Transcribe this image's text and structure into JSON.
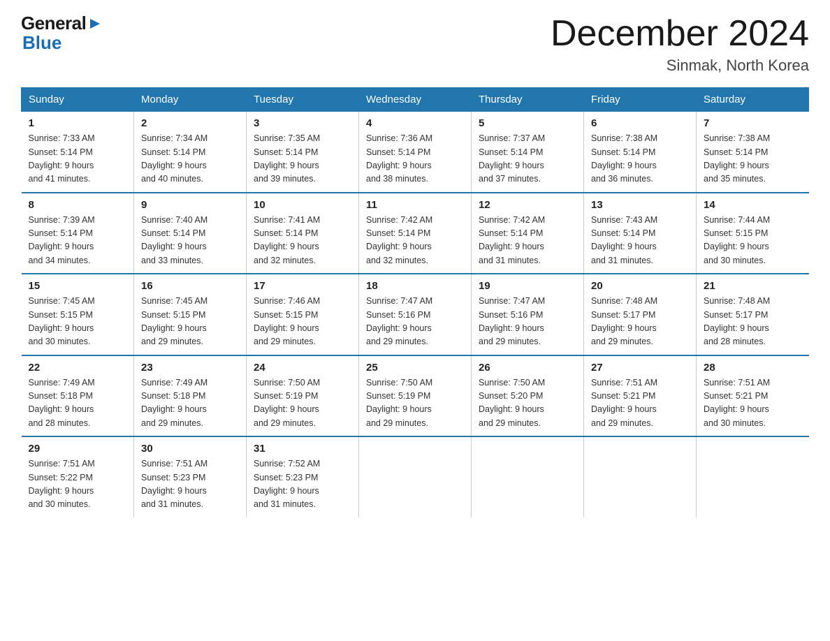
{
  "logo": {
    "general": "General",
    "blue": "Blue",
    "arrow": "▶"
  },
  "title": "December 2024",
  "location": "Sinmak, North Korea",
  "days_of_week": [
    "Sunday",
    "Monday",
    "Tuesday",
    "Wednesday",
    "Thursday",
    "Friday",
    "Saturday"
  ],
  "weeks": [
    [
      {
        "day": "1",
        "sunrise": "7:33 AM",
        "sunset": "5:14 PM",
        "daylight": "9 hours and 41 minutes."
      },
      {
        "day": "2",
        "sunrise": "7:34 AM",
        "sunset": "5:14 PM",
        "daylight": "9 hours and 40 minutes."
      },
      {
        "day": "3",
        "sunrise": "7:35 AM",
        "sunset": "5:14 PM",
        "daylight": "9 hours and 39 minutes."
      },
      {
        "day": "4",
        "sunrise": "7:36 AM",
        "sunset": "5:14 PM",
        "daylight": "9 hours and 38 minutes."
      },
      {
        "day": "5",
        "sunrise": "7:37 AM",
        "sunset": "5:14 PM",
        "daylight": "9 hours and 37 minutes."
      },
      {
        "day": "6",
        "sunrise": "7:38 AM",
        "sunset": "5:14 PM",
        "daylight": "9 hours and 36 minutes."
      },
      {
        "day": "7",
        "sunrise": "7:38 AM",
        "sunset": "5:14 PM",
        "daylight": "9 hours and 35 minutes."
      }
    ],
    [
      {
        "day": "8",
        "sunrise": "7:39 AM",
        "sunset": "5:14 PM",
        "daylight": "9 hours and 34 minutes."
      },
      {
        "day": "9",
        "sunrise": "7:40 AM",
        "sunset": "5:14 PM",
        "daylight": "9 hours and 33 minutes."
      },
      {
        "day": "10",
        "sunrise": "7:41 AM",
        "sunset": "5:14 PM",
        "daylight": "9 hours and 32 minutes."
      },
      {
        "day": "11",
        "sunrise": "7:42 AM",
        "sunset": "5:14 PM",
        "daylight": "9 hours and 32 minutes."
      },
      {
        "day": "12",
        "sunrise": "7:42 AM",
        "sunset": "5:14 PM",
        "daylight": "9 hours and 31 minutes."
      },
      {
        "day": "13",
        "sunrise": "7:43 AM",
        "sunset": "5:14 PM",
        "daylight": "9 hours and 31 minutes."
      },
      {
        "day": "14",
        "sunrise": "7:44 AM",
        "sunset": "5:15 PM",
        "daylight": "9 hours and 30 minutes."
      }
    ],
    [
      {
        "day": "15",
        "sunrise": "7:45 AM",
        "sunset": "5:15 PM",
        "daylight": "9 hours and 30 minutes."
      },
      {
        "day": "16",
        "sunrise": "7:45 AM",
        "sunset": "5:15 PM",
        "daylight": "9 hours and 29 minutes."
      },
      {
        "day": "17",
        "sunrise": "7:46 AM",
        "sunset": "5:15 PM",
        "daylight": "9 hours and 29 minutes."
      },
      {
        "day": "18",
        "sunrise": "7:47 AM",
        "sunset": "5:16 PM",
        "daylight": "9 hours and 29 minutes."
      },
      {
        "day": "19",
        "sunrise": "7:47 AM",
        "sunset": "5:16 PM",
        "daylight": "9 hours and 29 minutes."
      },
      {
        "day": "20",
        "sunrise": "7:48 AM",
        "sunset": "5:17 PM",
        "daylight": "9 hours and 29 minutes."
      },
      {
        "day": "21",
        "sunrise": "7:48 AM",
        "sunset": "5:17 PM",
        "daylight": "9 hours and 28 minutes."
      }
    ],
    [
      {
        "day": "22",
        "sunrise": "7:49 AM",
        "sunset": "5:18 PM",
        "daylight": "9 hours and 28 minutes."
      },
      {
        "day": "23",
        "sunrise": "7:49 AM",
        "sunset": "5:18 PM",
        "daylight": "9 hours and 29 minutes."
      },
      {
        "day": "24",
        "sunrise": "7:50 AM",
        "sunset": "5:19 PM",
        "daylight": "9 hours and 29 minutes."
      },
      {
        "day": "25",
        "sunrise": "7:50 AM",
        "sunset": "5:19 PM",
        "daylight": "9 hours and 29 minutes."
      },
      {
        "day": "26",
        "sunrise": "7:50 AM",
        "sunset": "5:20 PM",
        "daylight": "9 hours and 29 minutes."
      },
      {
        "day": "27",
        "sunrise": "7:51 AM",
        "sunset": "5:21 PM",
        "daylight": "9 hours and 29 minutes."
      },
      {
        "day": "28",
        "sunrise": "7:51 AM",
        "sunset": "5:21 PM",
        "daylight": "9 hours and 30 minutes."
      }
    ],
    [
      {
        "day": "29",
        "sunrise": "7:51 AM",
        "sunset": "5:22 PM",
        "daylight": "9 hours and 30 minutes."
      },
      {
        "day": "30",
        "sunrise": "7:51 AM",
        "sunset": "5:23 PM",
        "daylight": "9 hours and 31 minutes."
      },
      {
        "day": "31",
        "sunrise": "7:52 AM",
        "sunset": "5:23 PM",
        "daylight": "9 hours and 31 minutes."
      },
      null,
      null,
      null,
      null
    ]
  ],
  "labels": {
    "sunrise": "Sunrise:",
    "sunset": "Sunset:",
    "daylight": "Daylight:"
  }
}
